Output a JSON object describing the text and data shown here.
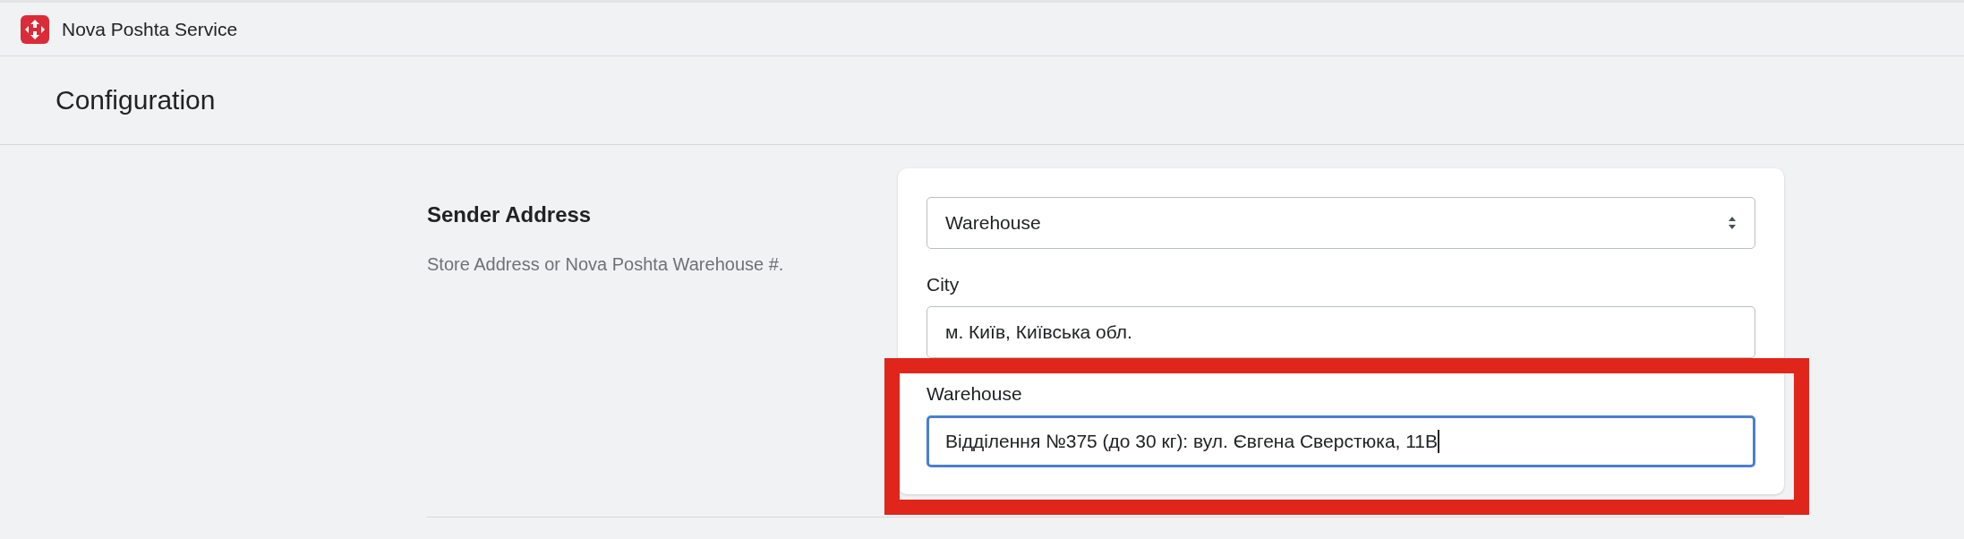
{
  "app_bar": {
    "title": "Nova Poshta Service"
  },
  "page": {
    "title": "Configuration"
  },
  "section": {
    "title": "Sender Address",
    "description": "Store Address or Nova Poshta Warehouse #."
  },
  "fields": [
    {
      "kind": "select",
      "value": "Warehouse",
      "focused": false,
      "highlighted": false
    },
    {
      "kind": "text",
      "label": "City",
      "value": "м. Київ, Київська обл.",
      "focused": false,
      "highlighted": false
    },
    {
      "kind": "text",
      "label": "Warehouse",
      "value": "Відділення №375 (до 30 кг): вул. Євгена Сверстюка, 11В",
      "focused": true,
      "highlighted": true
    }
  ]
}
